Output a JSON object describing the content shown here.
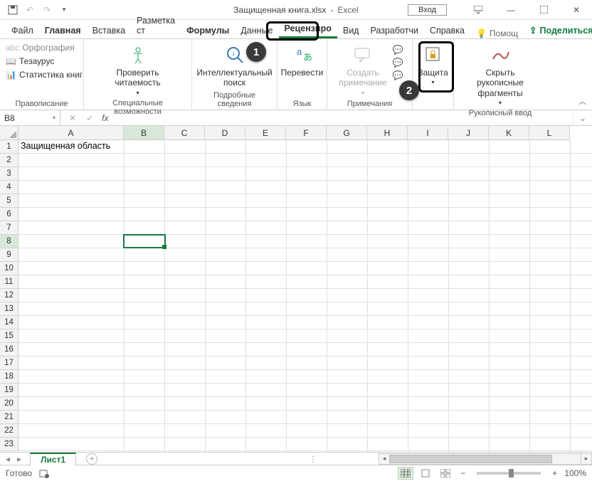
{
  "title": {
    "doc": "Защищенная книга.xlsx",
    "sep": "-",
    "app": "Excel"
  },
  "qat": {
    "login": "Вход"
  },
  "tabs": {
    "file": "Файл",
    "home": "Главная",
    "insert": "Вставка",
    "layout": "Разметка ст",
    "formulas": "Формулы",
    "data": "Данные",
    "review": "Рецензиро",
    "view": "Вид",
    "developer": "Разработчи",
    "help": "Справка",
    "tellme": "Помощ",
    "share": "Поделиться"
  },
  "ribbon": {
    "proofing": {
      "label": "Правописание",
      "spelling": "Орфография",
      "thesaurus": "Тезаурус",
      "stats": "Статистика книг"
    },
    "accessibility": {
      "label": "Специальные возможности",
      "check": "Проверить\nчитаемость"
    },
    "insights": {
      "label": "Подробные сведения",
      "smart": "Интеллектуальный\nпоиск"
    },
    "language": {
      "label": "Язык",
      "translate": "Перевести"
    },
    "comments": {
      "label": "Примечания",
      "new": "Создать\nпримечание"
    },
    "protect": {
      "label": "",
      "btn": "Защита"
    },
    "ink": {
      "label": "Рукописный ввод",
      "hide": "Скрыть рукописные\nфрагменты"
    }
  },
  "namebox": "B8",
  "columns": [
    "A",
    "B",
    "C",
    "D",
    "E",
    "F",
    "G",
    "H",
    "I",
    "J",
    "K",
    "L"
  ],
  "rows_count": 23,
  "cellA1": "Защищенная область",
  "sheet": "Лист1",
  "status": "Готово",
  "zoom": "100%"
}
